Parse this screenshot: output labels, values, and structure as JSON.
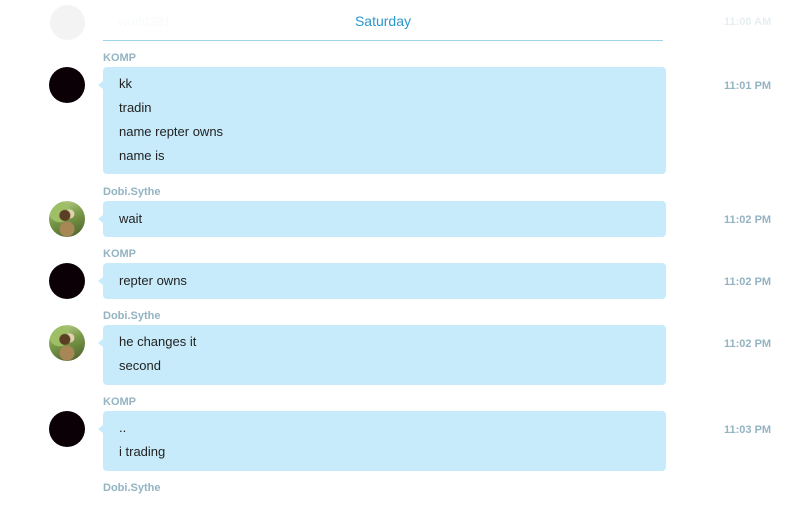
{
  "previous": {
    "sender": "world381",
    "time": "11:00 AM"
  },
  "date_separator": "Saturday",
  "messages": [
    {
      "sender": "KOMP",
      "avatar": "dark-avatar",
      "lines": [
        "kk",
        "tradin",
        "name repter owns",
        "name is"
      ],
      "time": "11:01 PM"
    },
    {
      "sender": "Dobi.Sythe",
      "avatar": "squirrel-photo-avatar",
      "lines": [
        "wait"
      ],
      "time": "11:02 PM"
    },
    {
      "sender": "KOMP",
      "avatar": "dark-avatar",
      "lines": [
        "repter owns"
      ],
      "time": "11:02 PM"
    },
    {
      "sender": "Dobi.Sythe",
      "avatar": "squirrel-photo-avatar",
      "lines": [
        "he changes it",
        "second"
      ],
      "time": "11:02 PM"
    },
    {
      "sender": "KOMP",
      "avatar": "dark-avatar",
      "lines": [
        "..",
        "i trading"
      ],
      "time": "11:03 PM"
    },
    {
      "sender": "Dobi.Sythe"
    }
  ],
  "colors": {
    "bubble": "#c7ebfa",
    "sender": "#94b3c3",
    "date": "#2a98cc"
  }
}
